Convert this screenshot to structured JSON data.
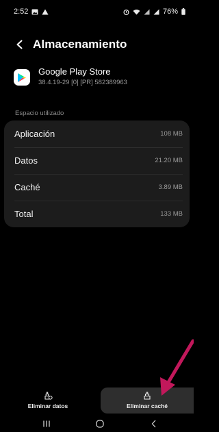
{
  "status": {
    "time": "2:52",
    "battery": "76%"
  },
  "header": {
    "title": "Almacenamiento"
  },
  "app": {
    "name": "Google Play Store",
    "version": "38.4.19-29 [0] [PR] 582389963"
  },
  "storage": {
    "section_label": "Espacio utilizado",
    "rows": [
      {
        "label": "Aplicación",
        "value": "108 MB"
      },
      {
        "label": "Datos",
        "value": "21.20 MB"
      },
      {
        "label": "Caché",
        "value": "3.89 MB"
      },
      {
        "label": "Total",
        "value": "133 MB"
      }
    ]
  },
  "actions": {
    "clear_data": "Eliminar datos",
    "clear_cache": "Eliminar caché"
  },
  "annotation": {
    "color": "#c2185b"
  },
  "icons": [
    "image-icon",
    "warning-icon",
    "alarm-icon",
    "wifi-icon",
    "signal-icon",
    "battery-icon",
    "back-arrow-icon",
    "play-store-icon",
    "eraser-icon",
    "recents-icon",
    "home-icon",
    "back-nav-icon"
  ]
}
